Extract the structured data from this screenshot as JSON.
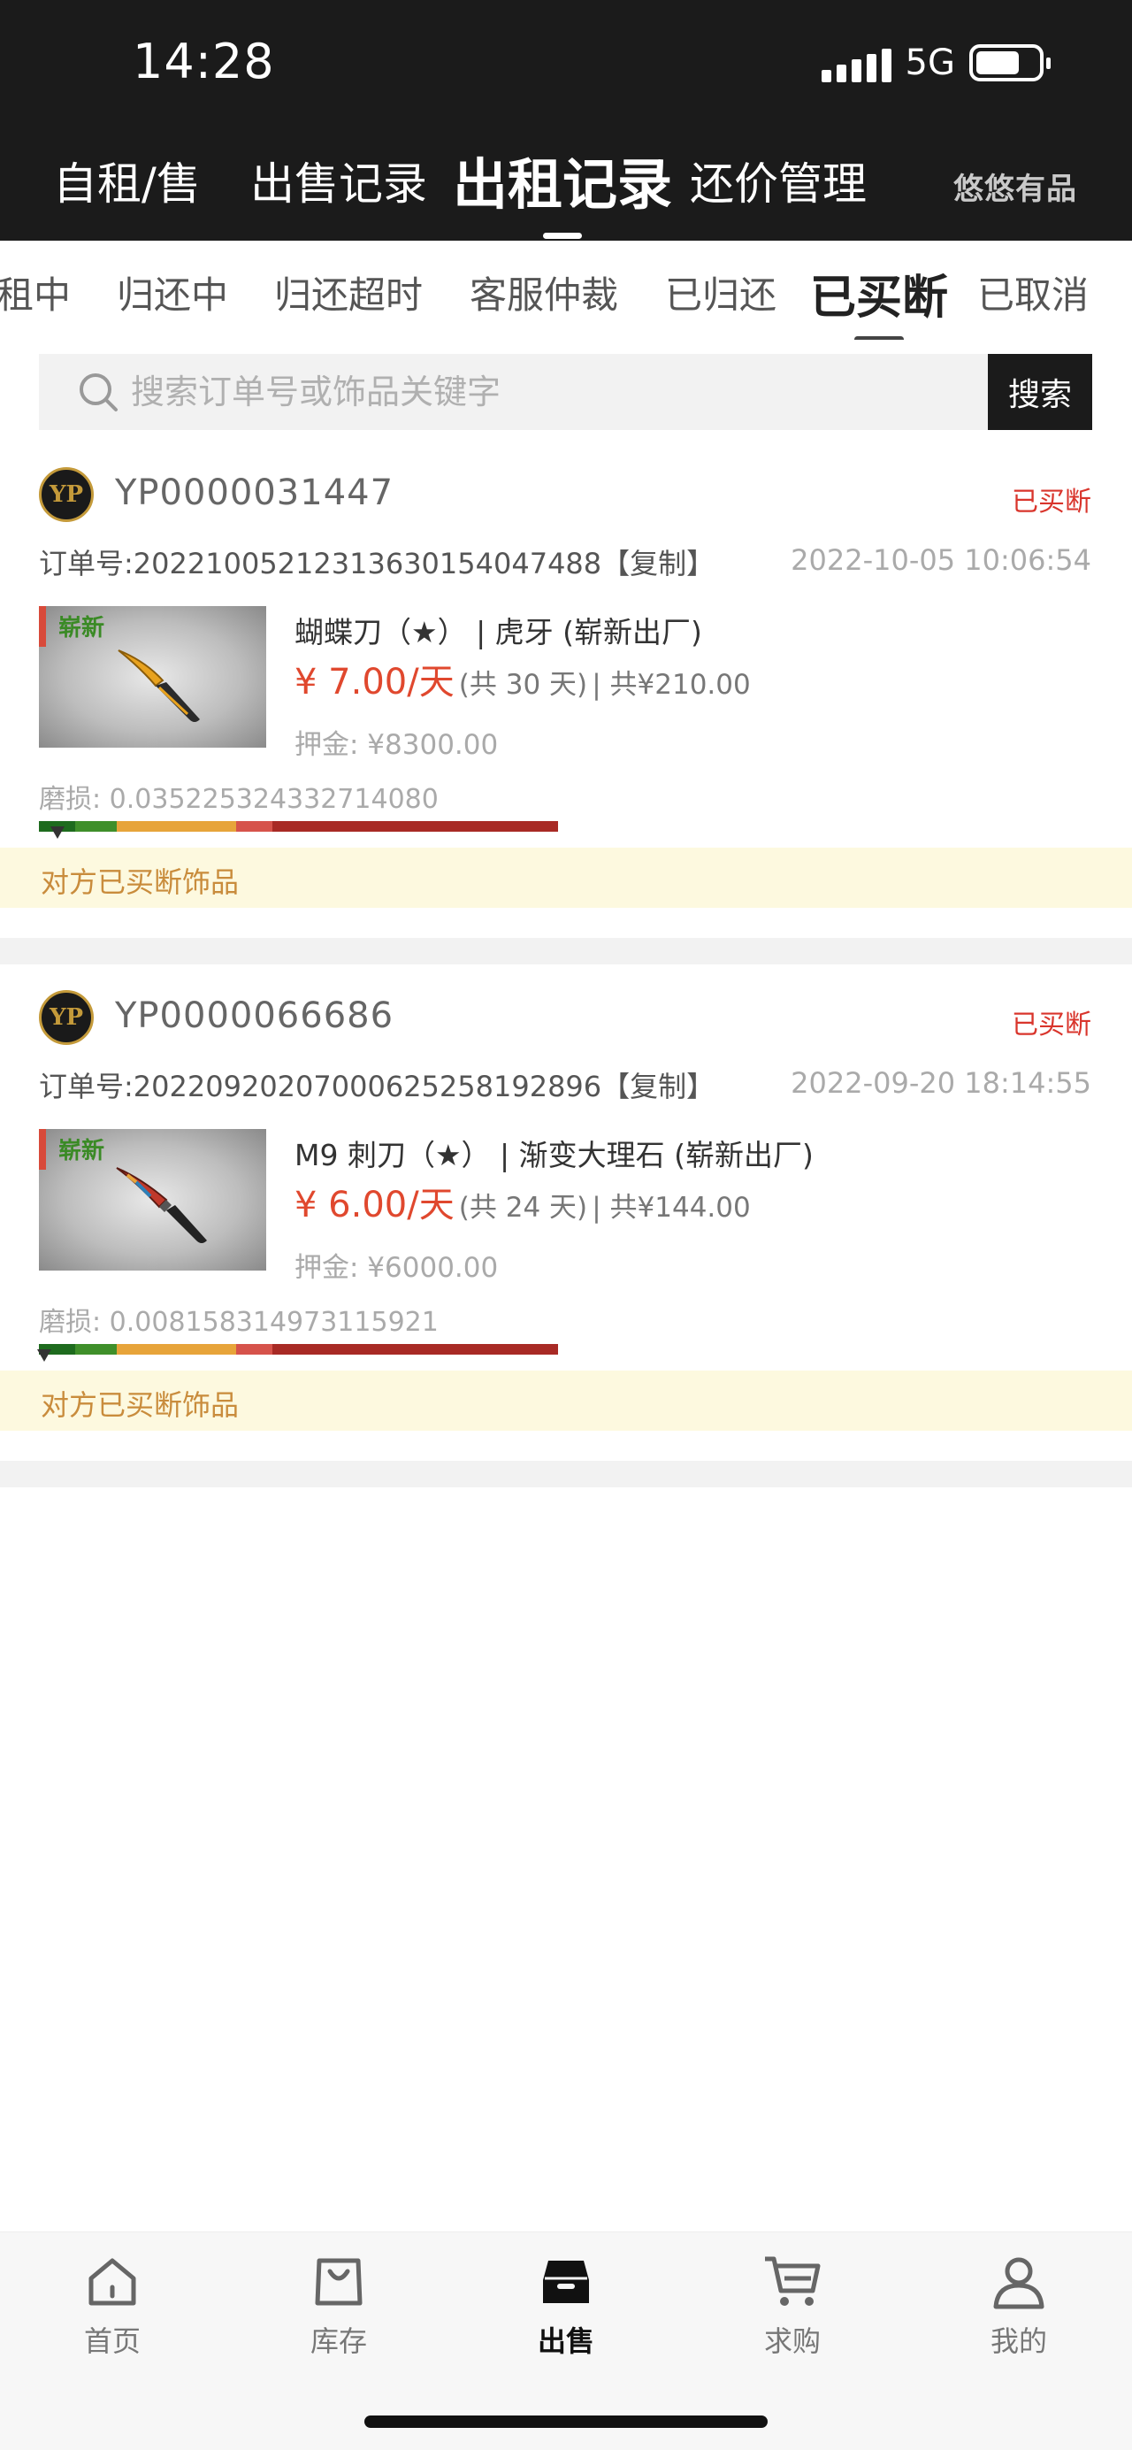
{
  "status_bar": {
    "time": "14:28",
    "network": "5G",
    "battery_level": 0.7
  },
  "header": {
    "tabs": [
      {
        "label": "自租/售",
        "active": false
      },
      {
        "label": "出售记录",
        "active": false
      },
      {
        "label": "出租记录",
        "active": true
      },
      {
        "label": "还价管理",
        "active": false
      }
    ],
    "brand": "悠悠有品"
  },
  "sub_tabs": [
    {
      "label": "租中",
      "active": false
    },
    {
      "label": "归还中",
      "active": false
    },
    {
      "label": "归还超时",
      "active": false
    },
    {
      "label": "客服仲裁",
      "active": false
    },
    {
      "label": "已归还",
      "active": false
    },
    {
      "label": "已买断",
      "active": true
    },
    {
      "label": "已取消",
      "active": false
    }
  ],
  "search": {
    "placeholder": "搜索订单号或饰品关键字",
    "value": "",
    "button_label": "搜索"
  },
  "orders": [
    {
      "seller_id": "YP0000031447",
      "status": "已买断",
      "order_no_label": "订单号:",
      "order_no": "20221005212313630154047488",
      "copy_label": "【复制】",
      "time": "2022-10-05 10:06:54",
      "item_tag": "崭新",
      "item_name": "蝴蝶刀（★） | 虎牙 (崭新出厂)",
      "price": "¥ 7.00/天",
      "period": "(共 30 天)",
      "total": "| 共¥210.00",
      "deposit": "押金: ¥8300.00",
      "wear": "磨损: 0.035225324332714080",
      "wear_value": 0.03522532433271408,
      "notice": "对方已买断饰品",
      "knife_colors": {
        "blade": "#e8a21e",
        "handle": "#2b2b2b"
      }
    },
    {
      "seller_id": "YP0000066686",
      "status": "已买断",
      "order_no_label": "订单号:",
      "order_no": "20220920207000625258192896",
      "copy_label": "【复制】",
      "time": "2022-09-20 18:14:55",
      "item_tag": "崭新",
      "item_name": "M9 刺刀（★） | 渐变大理石 (崭新出厂)",
      "price": "¥ 6.00/天",
      "period": "(共 24 天)",
      "total": "| 共¥144.00",
      "deposit": "押金: ¥6000.00",
      "wear": "磨损: 0.008158314973115921",
      "wear_value": 0.008158314973115921,
      "notice": "对方已买断饰品",
      "knife_colors": {
        "blade": "#c0392b",
        "handle": "#222222"
      }
    }
  ],
  "wear_scale": {
    "colors": [
      "#1e6b1e",
      "#3f8f2a",
      "#e7a43a",
      "#d6534b",
      "#a82a25"
    ],
    "breakpoints": [
      0,
      0.07,
      0.15,
      0.38,
      0.45,
      1.0
    ]
  },
  "bottom_nav": [
    {
      "label": "首页",
      "icon": "home-icon",
      "active": false
    },
    {
      "label": "库存",
      "icon": "inventory-bag-icon",
      "active": false
    },
    {
      "label": "出售",
      "icon": "sell-box-icon",
      "active": true
    },
    {
      "label": "求购",
      "icon": "cart-icon",
      "active": false
    },
    {
      "label": "我的",
      "icon": "profile-icon",
      "active": false
    }
  ],
  "colors": {
    "header_bg": "#1b1b1b",
    "status_red": "#d9352c",
    "price_orange": "#e0482e",
    "notice_bg": "#fdf9df",
    "notice_text": "#c98c3c"
  }
}
